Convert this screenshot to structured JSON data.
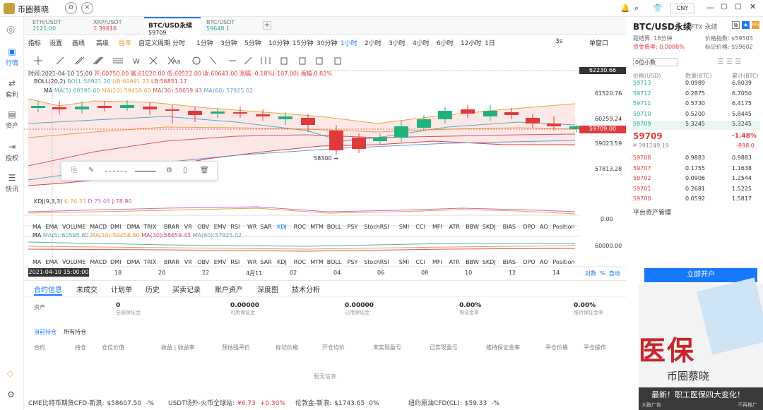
{
  "app": {
    "title": "币圈蔡晓",
    "currency": "CNY"
  },
  "sidebar": {
    "items": [
      {
        "label": "行情"
      },
      {
        "label": "套利"
      },
      {
        "label": "资产"
      },
      {
        "label": "授权"
      },
      {
        "label": "快讯"
      }
    ]
  },
  "tabs": [
    {
      "symbol": "ETH/USDT",
      "price": "2121.00"
    },
    {
      "symbol": "XRP/USDT",
      "price": "1.39616"
    },
    {
      "symbol": "BTC/USD永续",
      "price": "59709"
    },
    {
      "symbol": "BTC/USDT",
      "price": "59648.1"
    }
  ],
  "toolbar": {
    "items": [
      "指标",
      "设置",
      "画线",
      "高级",
      "胜率",
      "自定义周期",
      "分时",
      "1分钟",
      "3分钟",
      "5分钟",
      "10分钟",
      "15分钟",
      "30分钟",
      "1小时",
      "2小时",
      "3小时",
      "4小时",
      "6小时",
      "12小时",
      "1日",
      "3s",
      "单窗口"
    ]
  },
  "ohlc": {
    "time": "时间:2021-04-10 15:00",
    "open": "开:60750.00",
    "high": "高:61020.00",
    "low": "低:60522.00",
    "close": "收:60643.00",
    "chg": "涨幅:-0.18%(-107.00)",
    "amp": "振幅:0.82%"
  },
  "boll": {
    "label": "BOLL(20,2)",
    "boll": "BOLL:58921.20",
    "ub": "UB:60991.23",
    "lb": "LB:56851.17"
  },
  "ma": {
    "label": "MA",
    "ma5": "MA(5):60595.60",
    "ma10": "MA(10):59458.60",
    "ma30": "MA(30):58659.43",
    "ma60": "MA(60):57925.02"
  },
  "kdj": {
    "label": "KDJ(9,3,3)",
    "k": "K:76.33",
    "d": "D:75.05",
    "j": "J:78.90"
  },
  "yaxis": [
    "62230.66",
    "61520.76",
    "60259.24",
    "59709.00",
    "59023.59",
    "57813.28",
    "0.00",
    "60000.00"
  ],
  "low_note": "58300",
  "indicators": [
    "MA",
    "EMA",
    "VOLUME",
    "MACD",
    "DMI",
    "DMA",
    "TRIX",
    "BRAR",
    "VR",
    "OBV",
    "EMV",
    "RSI",
    "WR",
    "SAR",
    "KDJ",
    "ROC",
    "MTM",
    "BOLL",
    "PSY",
    "StochRSI",
    "SMI",
    "CCI",
    "MFI",
    "ATR",
    "BBW",
    "SKDJ",
    "BIAS",
    "DPO",
    "AO",
    "Position"
  ],
  "xaxis": {
    "cursor": "2021-04-10 15:00:00",
    "ticks": [
      "18",
      "20",
      "22",
      "4月11",
      "02",
      "04",
      "06",
      "08",
      "10",
      "12",
      "14"
    ],
    "right": [
      "对数",
      "%",
      "自动"
    ]
  },
  "bottom": {
    "tabs": [
      "合约信息",
      "未成交",
      "计划单",
      "历史",
      "买卖记录",
      "账户资产",
      "深度图",
      "技术分析"
    ],
    "summary": [
      {
        "v": "0",
        "l": "全部保证金"
      },
      {
        "v": "0.00000",
        "l": "可用保证金"
      },
      {
        "v": "0.00000",
        "l": "已用保证金"
      },
      {
        "v": "0.00%",
        "l": "保证金率"
      },
      {
        "v": "0.00%",
        "l": "维持保证金率"
      }
    ],
    "asset_label": "资产",
    "subtabs": [
      "当前持仓",
      "所有持仓"
    ],
    "cols": [
      "合约",
      "持仓",
      "仓位价值",
      "收益 | 收益率",
      "预估强平价",
      "标记价格",
      "开仓均价",
      "未实现盈亏",
      "已实现盈亏",
      "维持保证金率",
      "平仓价格",
      "平仓操作"
    ],
    "empty": "暂无信息"
  },
  "orderbook": {
    "title": "BTC/USD永续",
    "exch": "FTX 永续",
    "interval": "距结算: 18分钟",
    "funding": "资金费率: 0.0088%",
    "index": "价格指数: $59503",
    "mark": "标记价格: $59602",
    "precision": "0位小数",
    "headers": [
      "价格(USD)",
      "数量(BTC)",
      "累计(BTC)"
    ],
    "asks": [
      {
        "p": "59713",
        "q": "0.0989",
        "c": "6.8039"
      },
      {
        "p": "59712",
        "q": "0.2875",
        "c": "6.7050"
      },
      {
        "p": "59711",
        "q": "0.5730",
        "c": "6.4175"
      },
      {
        "p": "59710",
        "q": "0.5200",
        "c": "5.8445"
      },
      {
        "p": "59709",
        "q": "5.3245",
        "c": "5.3245"
      }
    ],
    "last": "59709",
    "last_cny": "¥ 391249.19",
    "chg_pct": "-1.48%",
    "chg_abs": "-898.0",
    "bids": [
      {
        "p": "59708",
        "q": "0.9883",
        "c": "0.9883"
      },
      {
        "p": "59707",
        "q": "0.1755",
        "c": "1.1638"
      },
      {
        "p": "59702",
        "q": "0.0906",
        "c": "1.2544"
      },
      {
        "p": "59701",
        "q": "0.2681",
        "c": "1.5225"
      },
      {
        "p": "59700",
        "q": "0.0592",
        "c": "1.5817"
      }
    ],
    "asset_mgmt": "平台资产管理",
    "open_btn": "立即开户"
  },
  "ticker": [
    {
      "label": "CME比特币期货CFD-新浪:",
      "value": "$58607.50",
      "chg": "-%"
    },
    {
      "label": "USDT场外-火币全球站:",
      "value": "¥6.73",
      "chg": "+0.30%"
    },
    {
      "label": "伦敦金-新浪:",
      "value": "$1743.65",
      "chg": "0%"
    },
    {
      "label": "纽约原油CFD(CL):",
      "value": "$59.33",
      "chg": "-%"
    }
  ],
  "ad": {
    "big": "医保",
    "brand": "币圈蔡晓",
    "tag": "最新！职工医保四大变化！",
    "left": "大鞍广告",
    "right": "不再推广"
  },
  "colors": {
    "up": "#21b27c",
    "down": "#e03b3b",
    "accent": "#1677ff"
  }
}
